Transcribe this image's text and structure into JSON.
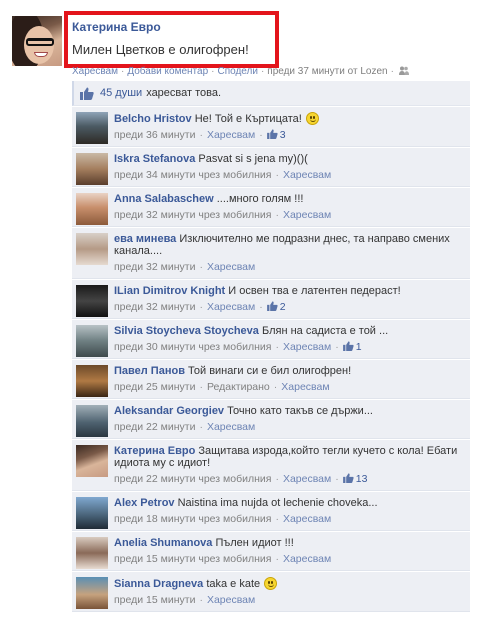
{
  "post": {
    "author": "Катерина Евро",
    "message": "Милен Цветков е олигофрен!",
    "actions": {
      "like": "Харесвам",
      "comment": "Добави коментар",
      "share": "Сподели",
      "time": "преди 37 минути от Lozen"
    }
  },
  "likes": {
    "count": "45 души",
    "text": "харесват това."
  },
  "comments": [
    {
      "author": "Belcho Hristov",
      "text": "Не! Той е Къртицата!",
      "time": "преди 36 минути",
      "via": "",
      "like": "Харесвам",
      "likes": "3",
      "smiley": true
    },
    {
      "author": "Iskra Stefanova",
      "text": "Pasvat si s jena my)()(",
      "time": "преди 34 минути",
      "via": "чрез мобилния",
      "like": "Харесвам",
      "likes": "",
      "smiley": false
    },
    {
      "author": "Anna Salabaschew",
      "text": "....много голям !!!",
      "time": "преди 32 минути",
      "via": "чрез мобилния",
      "like": "Харесвам",
      "likes": "",
      "smiley": false
    },
    {
      "author": "ева минева",
      "text": "Изключително ме подразни днес, та направо смених канала....",
      "time": "преди 32 минути",
      "via": "",
      "like": "Харесвам",
      "likes": "",
      "smiley": false
    },
    {
      "author": "ILian Dimitrov Knight",
      "text": "И освен тва е латентен педераст!",
      "time": "преди 32 минути",
      "via": "",
      "like": "Харесвам",
      "likes": "2",
      "smiley": false
    },
    {
      "author": "Silvia Stoycheva Stoycheva",
      "text": "Блян на садиста е той ...",
      "time": "преди 30 минути",
      "via": "чрез мобилния",
      "like": "Харесвам",
      "likes": "1",
      "smiley": false
    },
    {
      "author": "Павел Панов",
      "text": "Той винаги си е бил олигофрен!",
      "time": "преди 25 минути",
      "via": "",
      "like": "Харесвам",
      "likes": "",
      "smiley": false,
      "edited": "Редактирано"
    },
    {
      "author": "Aleksandar Georgiev",
      "text": "Точно като такъв се държи...",
      "time": "преди 22 минути",
      "via": "",
      "like": "Харесвам",
      "likes": "",
      "smiley": false
    },
    {
      "author": "Катерина Евро",
      "text": "Защитава изрода,който тегли кучето с кола! Ебати идиота му с идиот!",
      "time": "преди 22 минути",
      "via": "чрез мобилния",
      "like": "Харесвам",
      "likes": "13",
      "smiley": false
    },
    {
      "author": "Alex Petrov",
      "text": "Naistina ima nujda ot lechenie choveka...",
      "time": "преди 18 минути",
      "via": "чрез мобилния",
      "like": "Харесвам",
      "likes": "",
      "smiley": false
    },
    {
      "author": "Anelia Shumanova",
      "text": "Пълен идиот !!!",
      "time": "преди 15 минути",
      "via": "чрез мобилния",
      "like": "Харесвам",
      "likes": "",
      "smiley": false
    },
    {
      "author": "Sianna Dragneva",
      "text": "taka e kate",
      "time": "преди 15 минути",
      "via": "",
      "like": "Харесвам",
      "likes": "",
      "smiley": true
    }
  ]
}
